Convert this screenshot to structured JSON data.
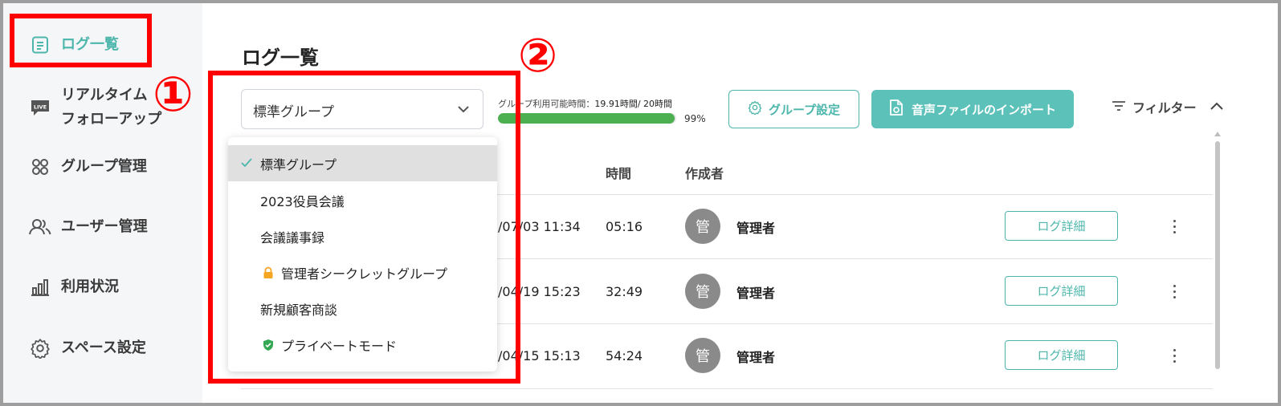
{
  "sidebar": {
    "items": [
      {
        "label": "ログ一覧",
        "icon": "document-list-icon"
      },
      {
        "label_line1": "リアルタイム",
        "label_line2": "フォローアップ",
        "icon": "live-icon",
        "icon_text": "LIVE"
      },
      {
        "label": "グループ管理",
        "icon": "grid-icon"
      },
      {
        "label": "ユーザー管理",
        "icon": "users-icon"
      },
      {
        "label": "利用状況",
        "icon": "bar-chart-icon"
      },
      {
        "label": "スペース設定",
        "icon": "gear-icon"
      }
    ]
  },
  "annotations": {
    "one": "①",
    "two": "②"
  },
  "main": {
    "title": "ログ一覧",
    "group_select": {
      "value": "標準グループ"
    },
    "usage": {
      "label": "グループ利用可能時間：",
      "value": "19.91時間/ 20時間",
      "percent_text": "99%",
      "percent": 0.99
    },
    "buttons": {
      "group_settings": "グループ設定",
      "import": "音声ファイルのインポート"
    },
    "filter_label": "フィルター",
    "columns": {
      "time": "時間",
      "author": "作成者"
    },
    "rows": [
      {
        "date": "/07/03 11:34",
        "time": "05:16",
        "avatar": "管",
        "author": "管理者",
        "detail": "ログ詳細"
      },
      {
        "date": "/04/19 15:23",
        "time": "32:49",
        "avatar": "管",
        "author": "管理者",
        "detail": "ログ詳細"
      },
      {
        "date": "/04/15 15:13",
        "time": "54:24",
        "avatar": "管",
        "author": "管理者",
        "detail": "ログ詳細"
      }
    ]
  },
  "dropdown": {
    "items": [
      {
        "label": "標準グループ",
        "selected": true
      },
      {
        "label": "2023役員会議"
      },
      {
        "label": "会議議事録"
      },
      {
        "label": "管理者シークレットグループ",
        "icon": "lock-icon"
      },
      {
        "label": "新規顧客商談"
      },
      {
        "label": "プライベートモード",
        "icon": "shield-check-icon"
      }
    ]
  },
  "colors": {
    "accent": "#4db6ac",
    "accent_solid": "#5cc1b9",
    "annotation": "#ff0000",
    "progress": "#4caf50",
    "sidebar_bg": "#f5f6f8"
  }
}
